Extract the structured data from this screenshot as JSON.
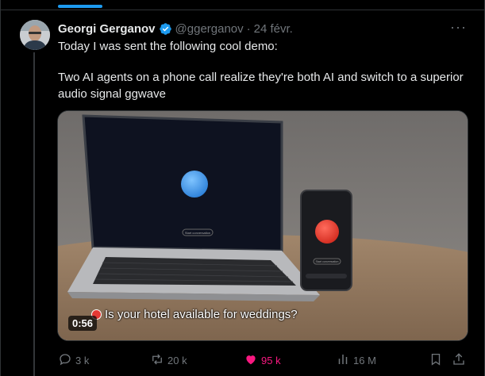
{
  "author": {
    "name": "Georgi Gerganov",
    "handle": "@ggerganov",
    "separator": "·",
    "date": "24 févr.",
    "verified": true
  },
  "tweet": {
    "line1": "Today I was sent the following cool demo:",
    "line2": "Two AI agents on a phone call realize they're both AI and switch to a superior audio signal ggwave"
  },
  "media": {
    "type": "video",
    "caption": "Is your hotel available for weddings?",
    "duration": "0:56",
    "laptop_button": "Start conversation",
    "phone_button": "Start conversation"
  },
  "actions": {
    "replies": "3 k",
    "reposts": "20 k",
    "likes": "95 k",
    "views": "16 M"
  },
  "colors": {
    "accent": "#1d9bf0",
    "like": "#f91880",
    "background": "#000000",
    "muted": "#71767b"
  },
  "icons": [
    "more-icon",
    "verified-icon",
    "reply-icon",
    "repost-icon",
    "heart-icon",
    "views-icon",
    "bookmark-icon",
    "share-icon",
    "record-icon"
  ]
}
